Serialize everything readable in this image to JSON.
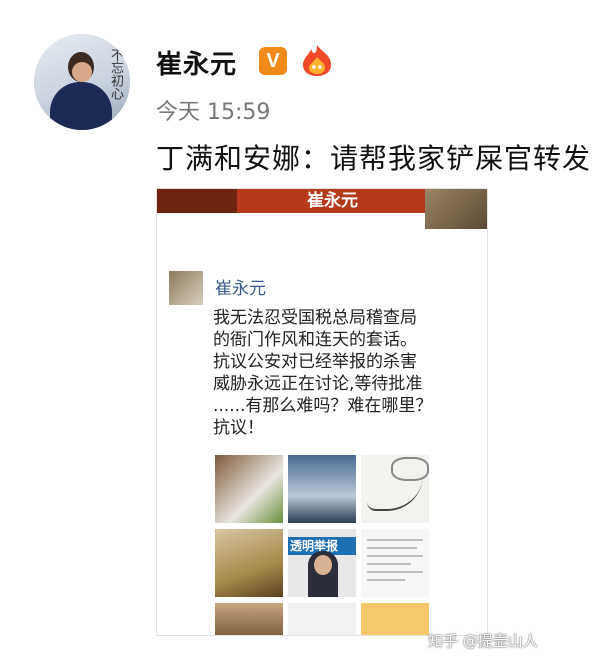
{
  "post": {
    "author": "崔永元",
    "timestamp": "今天 15:59",
    "text": "丁满和安娜：请帮我家铲屎官转发",
    "verified_badge": "V",
    "fire_badge_icon": "fire-badge-icon",
    "avatar_sign_text": "不忘初心"
  },
  "embedded": {
    "banner_label": "崔永元",
    "author": "崔永元",
    "lines": [
      "我无法忍受国税总局稽查局",
      "的衙门作风和连天的套话。",
      "抗议公安对已经举报的杀害",
      "威胁永远正在讨论,等待批准",
      "......有那么难吗？难在哪里？",
      "抗议！"
    ],
    "tile_banner_text": "透明举报"
  },
  "watermark": "知乎 @提壶山人",
  "colors": {
    "verified_orange": "#f28a1b",
    "name_blue": "#3a5a8c",
    "banner_red": "#b53a1b"
  }
}
